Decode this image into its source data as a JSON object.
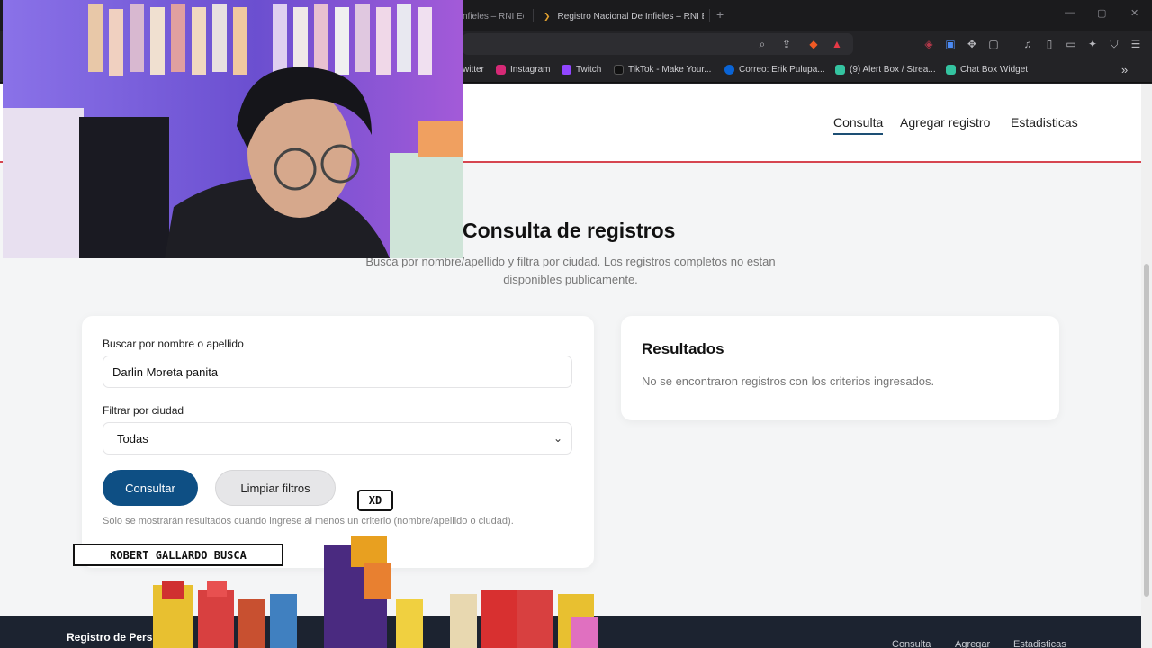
{
  "browser": {
    "tabs": [
      {
        "label": "nfieles – RNI Ec"
      },
      {
        "label": "Registro Nacional De Infieles – RNI Ec",
        "active": true
      }
    ],
    "new_tab_label": "+",
    "window_controls": [
      "—",
      "▢",
      "✕"
    ],
    "address_icons": [
      "zoom-icon",
      "share-icon",
      "brave-shield-icon",
      "brave-rewards-icon",
      "extension-icon",
      "translate-icon",
      "puzzle-icon",
      "screenshot-icon",
      "media-icon",
      "sidebar-icon",
      "wallet-icon",
      "leo-icon",
      "vpn-icon",
      "menu-icon"
    ],
    "bookmarks": [
      {
        "label": "witter",
        "color": "#1d9bf0"
      },
      {
        "label": "Instagram",
        "color": "#d62976"
      },
      {
        "label": "Twitch",
        "color": "#9146ff"
      },
      {
        "label": "TikTok - Make Your...",
        "color": "#111111"
      },
      {
        "label": "Correo: Erik Pulupa...",
        "color": "#0a64d6"
      },
      {
        "label": "(9) Alert Box / Strea...",
        "color": "#34c3a0"
      },
      {
        "label": "Chat Box Widget",
        "color": "#34c3a0"
      }
    ],
    "bookmarks_overflow": "»"
  },
  "header": {
    "nav": [
      {
        "label": "Consulta",
        "active": true
      },
      {
        "label": "Agregar registro"
      },
      {
        "label": "Estadisticas"
      }
    ],
    "accent_color": "#d64550"
  },
  "main": {
    "title": "Consulta de registros",
    "subtitle": "Busca por nombre/apellido y filtra por ciudad. Los registros completos no estan disponibles publicamente."
  },
  "form": {
    "name_label": "Buscar por nombre o apellido",
    "name_value": "Darlin Moreta panita",
    "city_label": "Filtrar por ciudad",
    "city_value": "Todas",
    "submit_label": "Consultar",
    "clear_label": "Limpiar filtros",
    "hint": "Solo se mostrarán resultados cuando ingrese al menos un criterio (nombre/apellido o ciudad).",
    "primary_color": "#0e4f84"
  },
  "results": {
    "title": "Resultados",
    "message": "No se encontraron registros con los criterios ingresados."
  },
  "footer": {
    "brand": "Registro de Pers",
    "links": [
      "Consulta",
      "Agregar",
      "Estadisticas"
    ]
  },
  "overlay": {
    "alert_text": "ROBERT GALLARDO BUSCA",
    "chat_bubble": "XD"
  }
}
